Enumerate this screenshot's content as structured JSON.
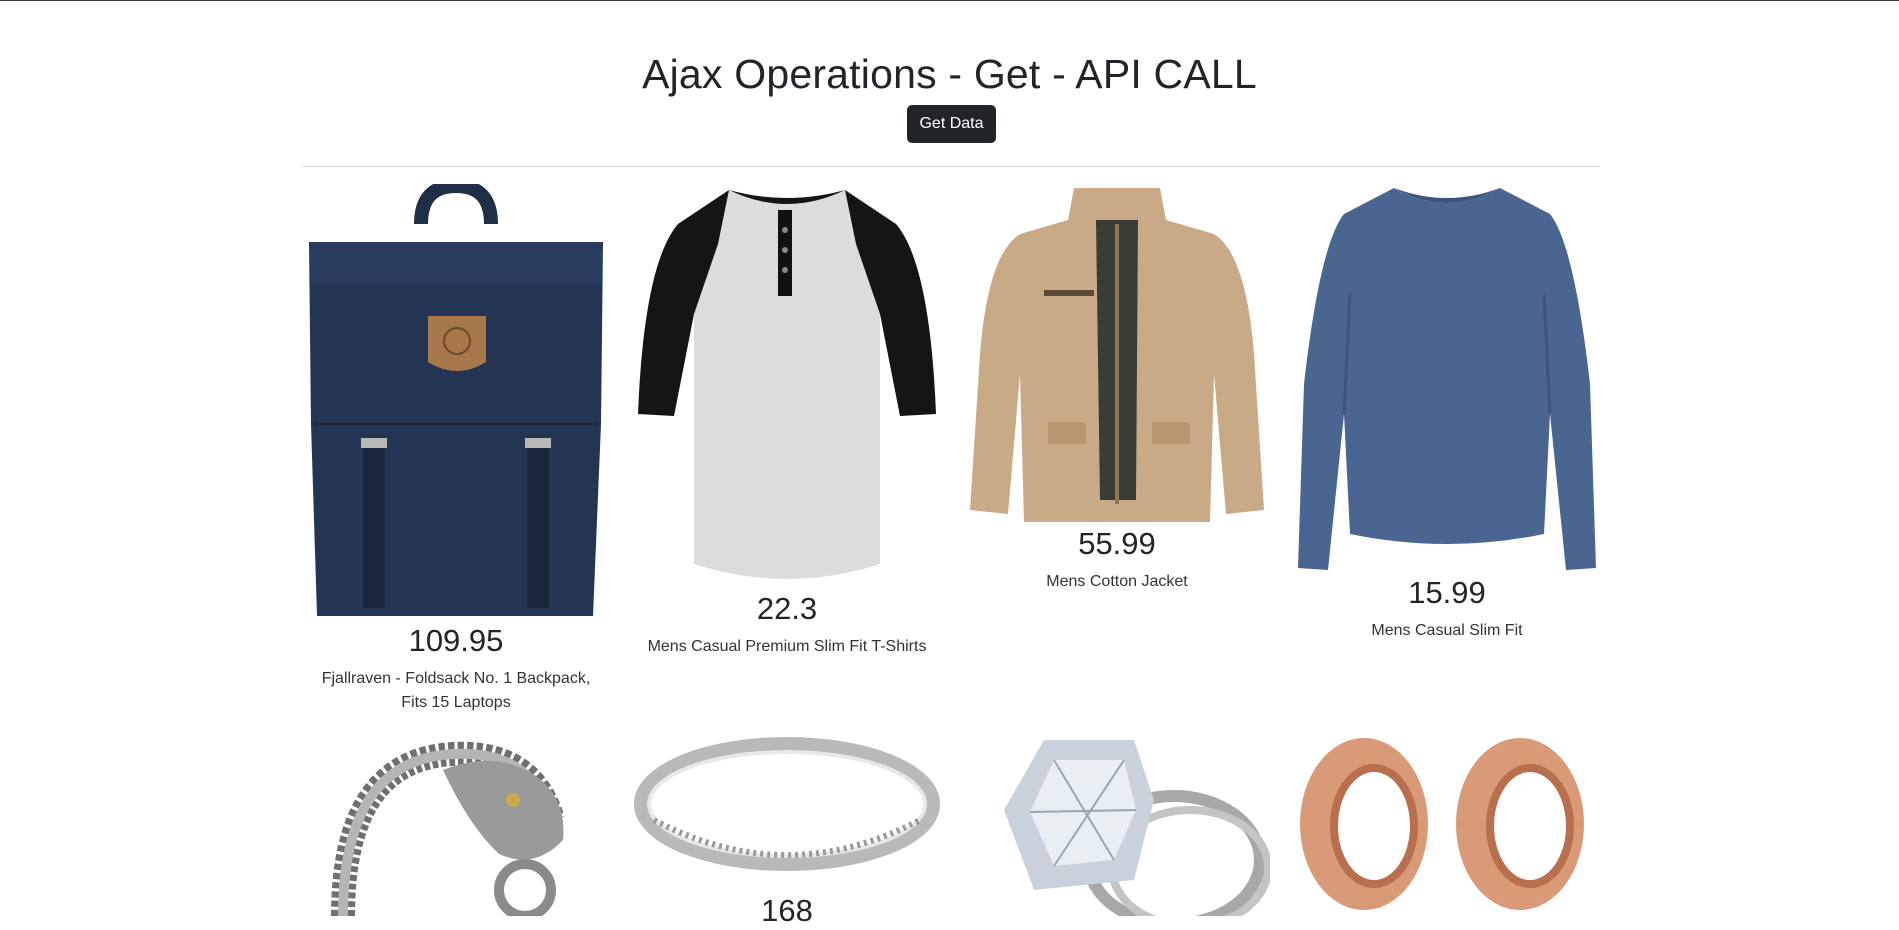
{
  "header": {
    "title": "Ajax Operations - Get - API CALL",
    "button_label": "Get Data"
  },
  "products": [
    {
      "price": "109.95",
      "title": "Fjallraven - Foldsack No. 1 Backpack, Fits 15 Laptops",
      "image": "backpack"
    },
    {
      "price": "22.3",
      "title": "Mens Casual Premium Slim Fit T-Shirts",
      "image": "raglan-t-shirt"
    },
    {
      "price": "55.99",
      "title": "Mens Cotton Jacket",
      "image": "cotton-jacket"
    },
    {
      "price": "15.99",
      "title": "Mens Casual Slim Fit",
      "image": "long-sleeve-shirt"
    },
    {
      "image": "dragon-chain-bracelet"
    },
    {
      "price": "168",
      "image": "silver-ring"
    },
    {
      "image": "diamond-ring-set"
    },
    {
      "image": "rose-gold-tunnel-plugs"
    }
  ]
}
